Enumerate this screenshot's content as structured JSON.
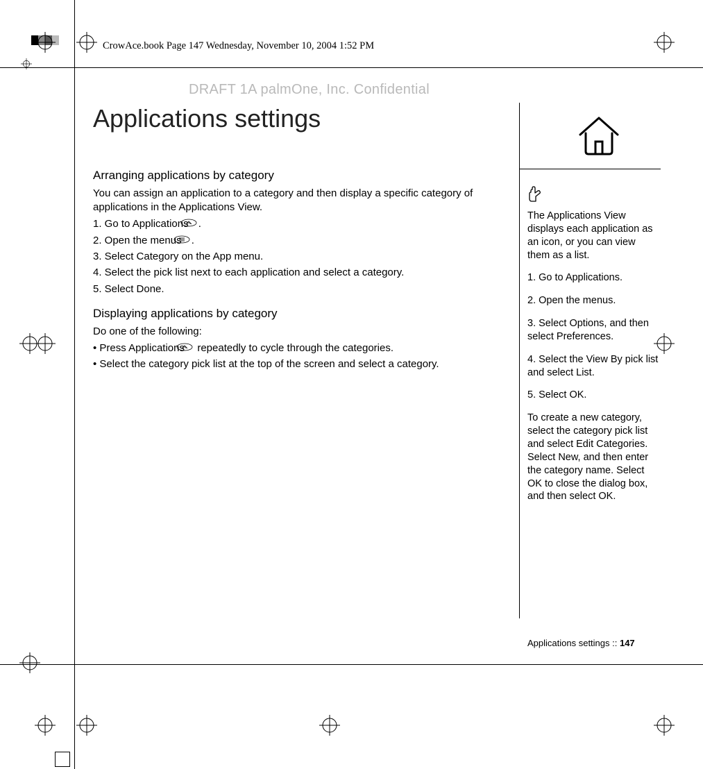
{
  "header_line": "CrowAce.book  Page 147  Wednesday, November 10, 2004  1:52 PM",
  "watermark": "DRAFT 1A  palmOne, Inc.   Confidential",
  "main_title": "Applications settings",
  "section1": {
    "heading": "Arranging applications by category",
    "intro": "You can assign an application to a category and then display a specific category of applications in the Applications View.",
    "steps": [
      "1.  Go to Applications ",
      "2.  Open the menus ",
      "3.  Select Category on the App menu.",
      "4.  Select the pick list next to each application and select a category.",
      "5.  Select Done."
    ],
    "step1_suffix": ".",
    "step2_suffix": "."
  },
  "section2": {
    "heading": "Displaying applications by category",
    "intro": "Do one of the following:",
    "bullets_prefix": "•   ",
    "bullets": [
      {
        "pre": "Press Applications ",
        "post": " repeatedly to cycle through the categories."
      },
      {
        "text": "Select the category pick list at the top of the screen and select a category."
      }
    ]
  },
  "sidebar": {
    "p1": "The Applications View displays each application as an icon, or you can view them as a list.",
    "p2": "1. Go to Applications.",
    "p3": "2. Open the menus.",
    "p4": "3. Select Options, and then select Preferences.",
    "p5": "4. Select the View By pick list and select List.",
    "p6": "5. Select OK.",
    "p7": "To create a new category, select the category pick list and select Edit Categories. Select New, and then enter the category name. Select OK to close the dialog box, and then select OK."
  },
  "footer": {
    "label": "Applications settings   ::   ",
    "page": "147"
  }
}
